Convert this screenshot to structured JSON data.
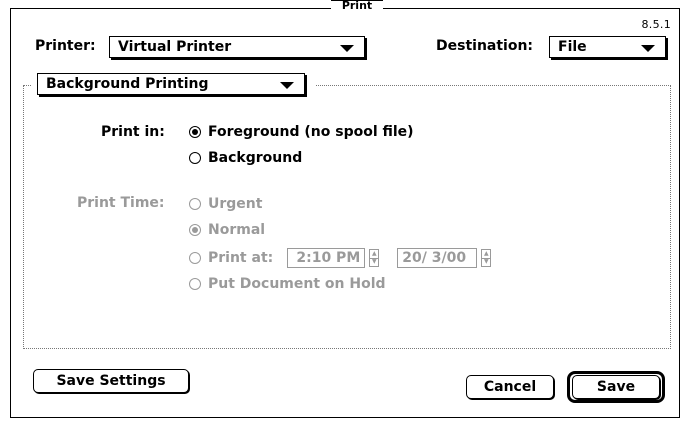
{
  "window": {
    "title_fragment": "Print",
    "version": "8.5.1"
  },
  "printer": {
    "label": "Printer:",
    "value": "Virtual Printer"
  },
  "destination": {
    "label": "Destination:",
    "value": "File"
  },
  "panel": {
    "value": "Background Printing"
  },
  "print_in": {
    "label": "Print in:",
    "options": [
      {
        "label": "Foreground (no spool file)",
        "checked": true
      },
      {
        "label": "Background",
        "checked": false
      }
    ]
  },
  "print_time": {
    "label": "Print Time:",
    "enabled": false,
    "options": [
      {
        "label": "Urgent",
        "checked": false
      },
      {
        "label": "Normal",
        "checked": true
      },
      {
        "label": "Print at:",
        "checked": false
      },
      {
        "label": "Put Document on Hold",
        "checked": false
      }
    ],
    "time_value": "2:10 PM",
    "date_value": "20/ 3/00"
  },
  "buttons": {
    "save_settings": "Save Settings",
    "cancel": "Cancel",
    "save": "Save"
  }
}
